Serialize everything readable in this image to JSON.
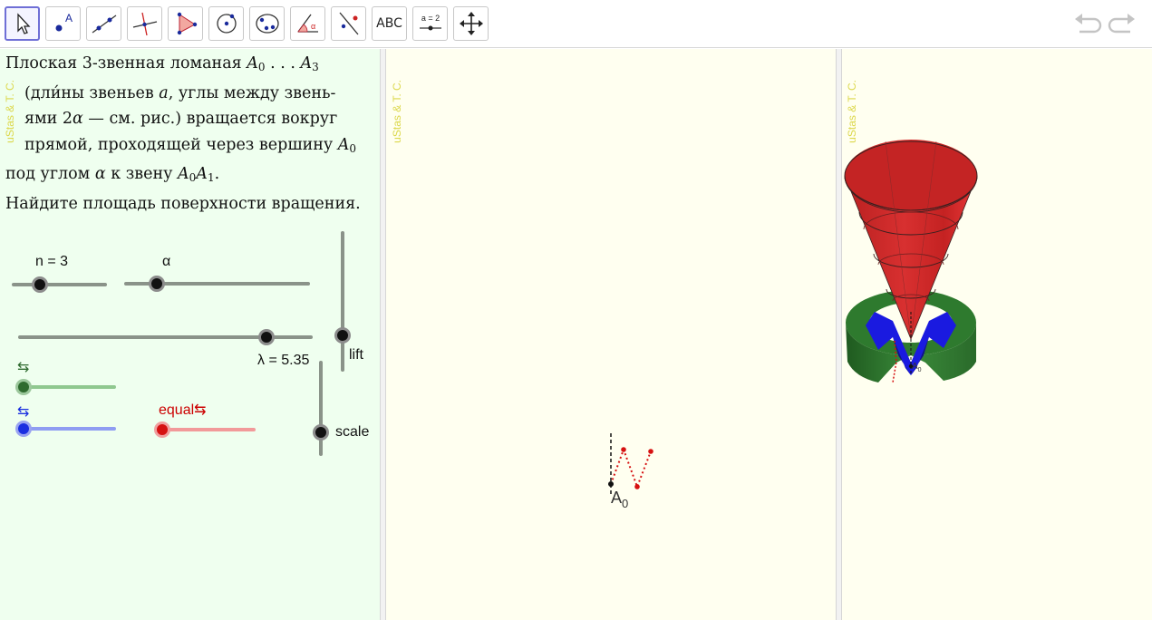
{
  "toolbar": {
    "tools": [
      {
        "name": "move-tool",
        "icon": "pointer-arrow-icon"
      },
      {
        "name": "point-tool",
        "icon": "point-icon",
        "label": "A"
      },
      {
        "name": "line-tool",
        "icon": "line-icon"
      },
      {
        "name": "perpendicular-tool",
        "icon": "perpendicular-line-icon"
      },
      {
        "name": "polygon-tool",
        "icon": "triangle-icon"
      },
      {
        "name": "circle-tool",
        "icon": "circle-icon"
      },
      {
        "name": "conic-tool",
        "icon": "ellipse-icon"
      },
      {
        "name": "angle-tool",
        "icon": "angle-icon",
        "label": "α"
      },
      {
        "name": "reflect-tool",
        "icon": "reflect-icon"
      },
      {
        "name": "text-tool",
        "icon": "text-icon",
        "label": "ABC"
      },
      {
        "name": "slider-tool",
        "icon": "slider-icon",
        "label": "a = 2"
      },
      {
        "name": "move-graphics-tool",
        "icon": "move-arrows-icon"
      }
    ],
    "undo_icon": "undo-icon",
    "redo_icon": "redo-icon",
    "accent_color": "#6f6fd6"
  },
  "watermark": "uStas & T. C.",
  "problem": {
    "line1_text": "Плоская 3-звенная ломаная ",
    "line1_math_a": "A",
    "line1_sub0": "0",
    "line1_dots": " . . . ",
    "line1_math_b": "A",
    "line1_sub3": "3",
    "line2_a": "(дли́ны звеньев ",
    "line2_var": "a",
    "line2_b": ", углы между звень-",
    "line3_a": "ями 2",
    "line3_var": "α",
    "line3_b": " — см. рис.) вращается вокруг",
    "line4_a": "прямой,  проходящей через вершину ",
    "line4_var": "A",
    "line4_sub": "0",
    "line5_a": "под углом ",
    "line5_var": "α",
    "line5_b": " к звену ",
    "line5_v1": "A",
    "line5_s1": "0",
    "line5_v2": "A",
    "line5_s2": "1",
    "line5_c": ".",
    "line6": "Найдите площадь поверхности вращения."
  },
  "sliders": {
    "n_label": "n = 3",
    "alpha_label": "α",
    "lambda_label": "λ = 5.35",
    "lift_label": "lift",
    "scale_label": "scale",
    "green_arrow": "⇆",
    "blue_arrow": "⇆",
    "equal_label": "equal⇆",
    "green_color": "#2f6b2f",
    "blue_color": "#1a2fe0",
    "red_color": "#d61111",
    "equal_color": "#cc0000"
  },
  "graphics2d": {
    "point_label": "A",
    "point_sub": "0",
    "polyline_color": "#d61111"
  },
  "graphics3d": {
    "point_label": "A",
    "point_sub": "0",
    "cone_color": "#d42020",
    "ring_color": "#2d7a2d",
    "inner_color": "#1a1ae0"
  }
}
